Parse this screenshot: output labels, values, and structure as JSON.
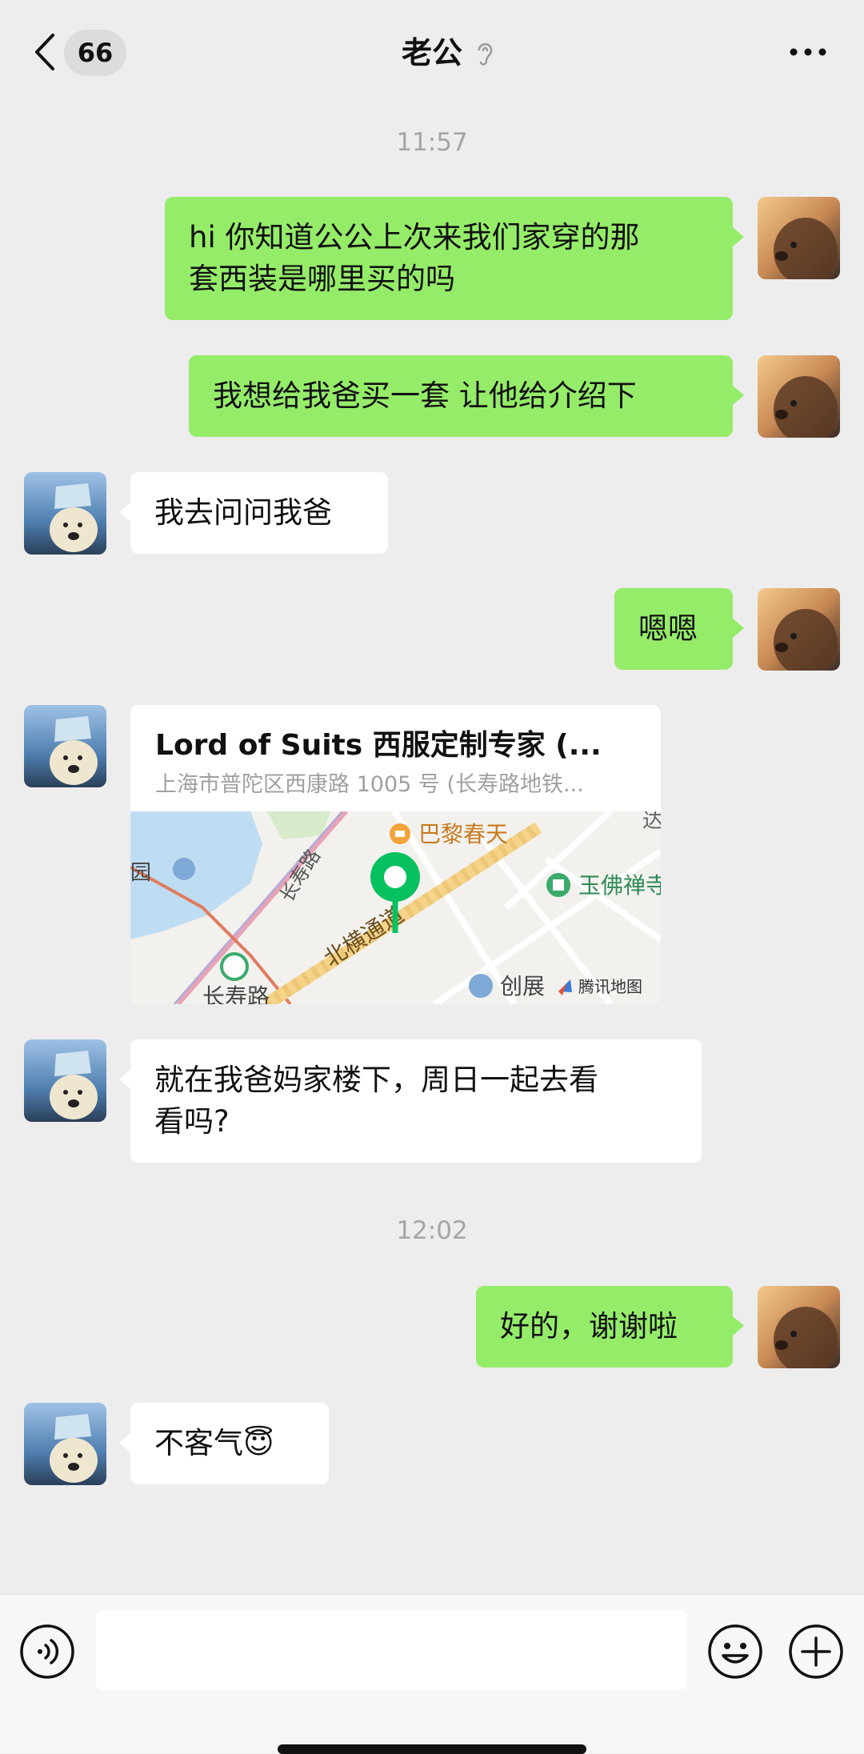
{
  "header": {
    "unread_count": "66",
    "title": "老公"
  },
  "timestamps": [
    "11:57",
    "12:02"
  ],
  "messages": [
    {
      "side": "right",
      "text": "hi 你知道公公上次来我们家穿的那\n套西装是哪里买的吗"
    },
    {
      "side": "right",
      "text": "我想给我爸买一套 让他给介绍下"
    },
    {
      "side": "left",
      "text": "我去问问我爸"
    },
    {
      "side": "right",
      "text": "嗯嗯"
    },
    {
      "side": "left",
      "text": "就在我爸妈家楼下，周日一起去看\n看吗?"
    },
    {
      "side": "right",
      "text": "好的，谢谢啦"
    },
    {
      "side": "left",
      "text": "不客气😇"
    }
  ],
  "location": {
    "title": "Lord of Suits 西服定制专家 (...",
    "address": "上海市普陀区西康路 1005 号 (长寿路地铁...",
    "map_labels": {
      "poi_top": "巴黎春天",
      "poi_right": "玉佛禅寺",
      "road_changshou": "长寿路",
      "road_changshou_bottom": "长寿路",
      "road_beiheng": "北横通道",
      "poi_left": "园",
      "poi_bottom": "创展",
      "corner_top": "达",
      "map_brand": "腾讯地图"
    }
  },
  "input": {
    "placeholder": ""
  },
  "colors": {
    "background": "#EDEDED",
    "bubble_self": "#95EC69",
    "bubble_other": "#FFFFFF",
    "map_pin": "#07C160"
  }
}
